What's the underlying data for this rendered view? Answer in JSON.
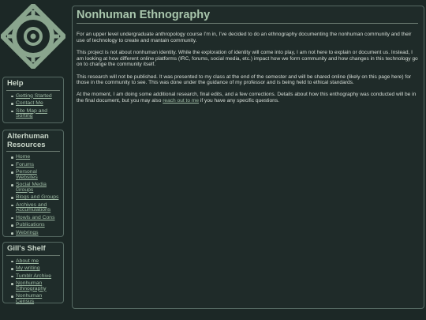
{
  "colors": {
    "background": "#1c2826",
    "panel_border": "#566a63",
    "title": "#a9c6ad",
    "link": "#9fbba5",
    "logo": "#8aa58e"
  },
  "logo": {
    "icon": "compass-eye-logo-icon"
  },
  "sidebar": {
    "help": {
      "title": "Help",
      "items": [
        {
          "label": "Getting Started"
        },
        {
          "label": "Contact Me"
        },
        {
          "label": "Site Map and Sorting"
        }
      ]
    },
    "alterhuman": {
      "title": "Alterhuman Resources",
      "items": [
        {
          "label": "Home"
        },
        {
          "label": "Forums"
        },
        {
          "label": "Personal Websites"
        },
        {
          "label": "Social Media Groups"
        },
        {
          "label": "Blogs and Groups"
        },
        {
          "label": "Archives and Accumulations"
        },
        {
          "label": "Howls and Cons"
        },
        {
          "label": "Publications"
        },
        {
          "label": "Webrings"
        }
      ]
    },
    "shelf": {
      "title": "Gill's Shelf",
      "items": [
        {
          "label": "About me"
        },
        {
          "label": "My writing"
        },
        {
          "label": "Tumblr Archive"
        },
        {
          "label": "Nonhuman Ethnography"
        },
        {
          "label": "Nonhuman Census"
        }
      ]
    }
  },
  "main": {
    "title": "Nonhuman Ethnography",
    "paragraphs": {
      "p1": "For an upper level undergraduate anthropology course I'm in, I've decided to do an ethnography documenting the nonhuman community and their use of technology to create and mantain community.",
      "p2": "This project is not about nonhuman identity. While the exploration of identity will come into play, I am not here to explain or document us. Instead, I am looking at how different online platforms (IRC, forums, social media, etc.) impact how we form community and how changes in this technology go on to change the community itself.",
      "p3": "This research will not be published. It was presented to my class at the end of the semester and will be shared online (likely on this page here) for those in the community to see. This was done under the guidance of my professor and is being held to ethical standards.",
      "p4_before": "At the moment, I am doing some additional research, final edits, and a few corrections. Details about how this enthography was conducted will be in the final document, but you may also ",
      "p4_link": "reach out to me",
      "p4_after": " if you have any specific questions."
    }
  }
}
